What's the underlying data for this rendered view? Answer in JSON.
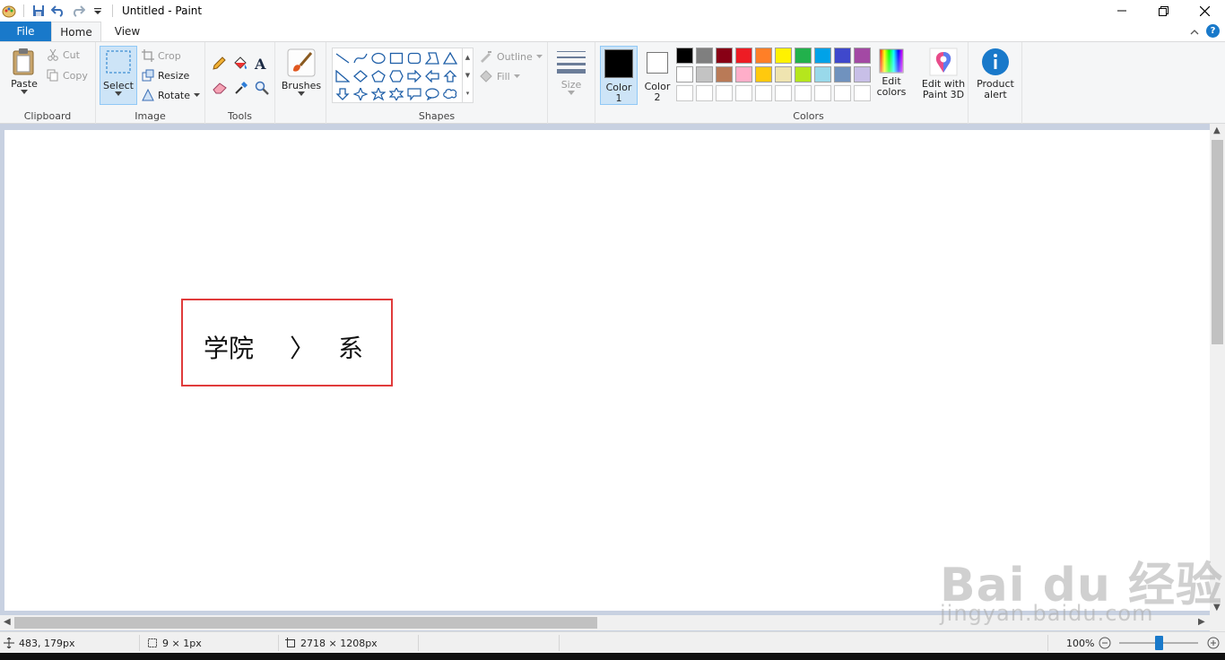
{
  "window": {
    "title": "Untitled - Paint"
  },
  "tabs": {
    "file": "File",
    "home": "Home",
    "view": "View"
  },
  "ribbon": {
    "clipboard": {
      "label": "Clipboard",
      "paste": "Paste",
      "cut": "Cut",
      "copy": "Copy"
    },
    "image": {
      "label": "Image",
      "select": "Select",
      "crop": "Crop",
      "resize": "Resize",
      "rotate": "Rotate"
    },
    "tools": {
      "label": "Tools"
    },
    "brushes": {
      "label": "Brushes"
    },
    "shapes": {
      "label": "Shapes",
      "outline": "Outline",
      "fill": "Fill"
    },
    "size": {
      "label": "Size"
    },
    "colors": {
      "label": "Colors",
      "color1": "Color",
      "color1_num": "1",
      "color2": "Color",
      "color2_num": "2",
      "edit_colors_1": "Edit",
      "edit_colors_2": "colors",
      "color1_value": "#000000",
      "color2_value": "#ffffff",
      "palette_row1": [
        "#000000",
        "#7f7f7f",
        "#880015",
        "#ed1c24",
        "#ff7f27",
        "#fff200",
        "#22b14c",
        "#00a2e8",
        "#3f48cc",
        "#a349a4"
      ],
      "palette_row2": [
        "#ffffff",
        "#c3c3c3",
        "#b97a57",
        "#ffaec9",
        "#ffc90e",
        "#efe4b0",
        "#b5e61d",
        "#99d9ea",
        "#7092be",
        "#c8bfe7"
      ],
      "palette_row3": [
        "#ffffff",
        "#ffffff",
        "#ffffff",
        "#ffffff",
        "#ffffff",
        "#ffffff",
        "#ffffff",
        "#ffffff",
        "#ffffff",
        "#ffffff"
      ]
    },
    "paint3d": {
      "line1": "Edit with",
      "line2": "Paint 3D"
    },
    "product_alert": {
      "line1": "Product",
      "line2": "alert"
    }
  },
  "canvas": {
    "text1": "学院",
    "arrow": "〉",
    "text2": "系"
  },
  "watermark": {
    "brand": "Bai du 经验",
    "url": "jingyan.baidu.com"
  },
  "status": {
    "cursor_pos": "483, 179px",
    "selection_size": "9 × 1px",
    "image_size": "2718 × 1208px",
    "zoom": "100%",
    "zoom_level": 0.5
  }
}
